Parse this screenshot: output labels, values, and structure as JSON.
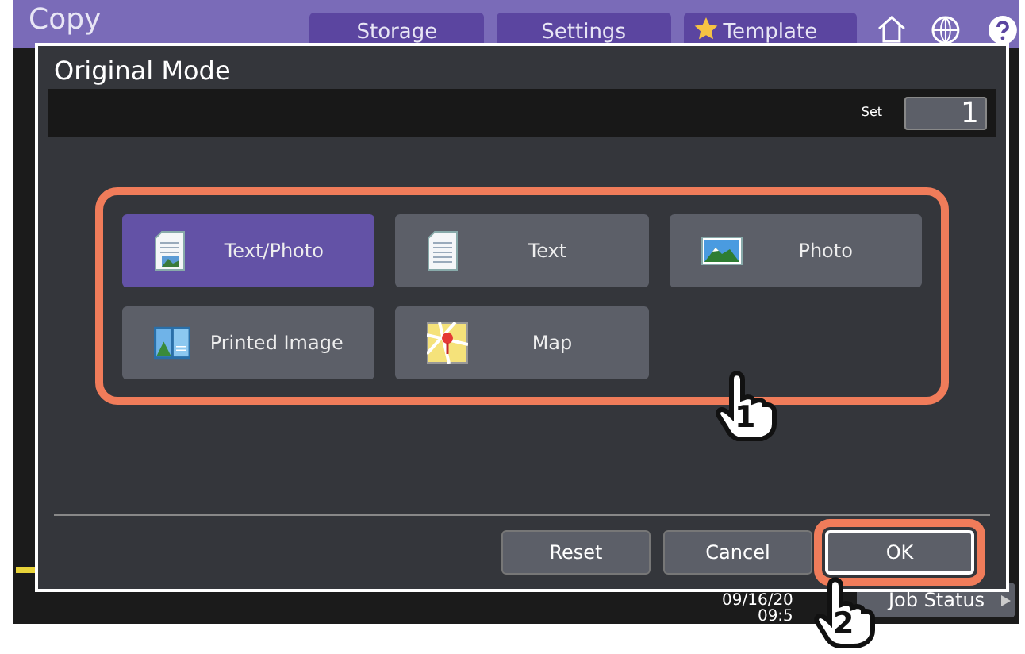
{
  "header": {
    "title": "Copy",
    "tabs": [
      {
        "label": "Storage"
      },
      {
        "label": "Settings"
      },
      {
        "label": "Template"
      }
    ]
  },
  "status": {
    "date": "09/16/20",
    "time": "09:5",
    "job_status": "Job Status"
  },
  "dialog": {
    "title": "Original Mode",
    "set_label": "Set",
    "set_value": "1",
    "modes": [
      {
        "label": "Text/Photo",
        "kind": "textphoto",
        "selected": true
      },
      {
        "label": "Text",
        "kind": "text",
        "selected": false
      },
      {
        "label": "Photo",
        "kind": "photo",
        "selected": false
      },
      {
        "label": "Printed Image",
        "kind": "printed",
        "selected": false
      },
      {
        "label": "Map",
        "kind": "map",
        "selected": false
      }
    ],
    "buttons": [
      {
        "label": "Reset",
        "highlighted": false
      },
      {
        "label": "Cancel",
        "highlighted": false
      },
      {
        "label": "OK",
        "highlighted": true
      }
    ]
  },
  "callouts": [
    "1",
    "2"
  ]
}
